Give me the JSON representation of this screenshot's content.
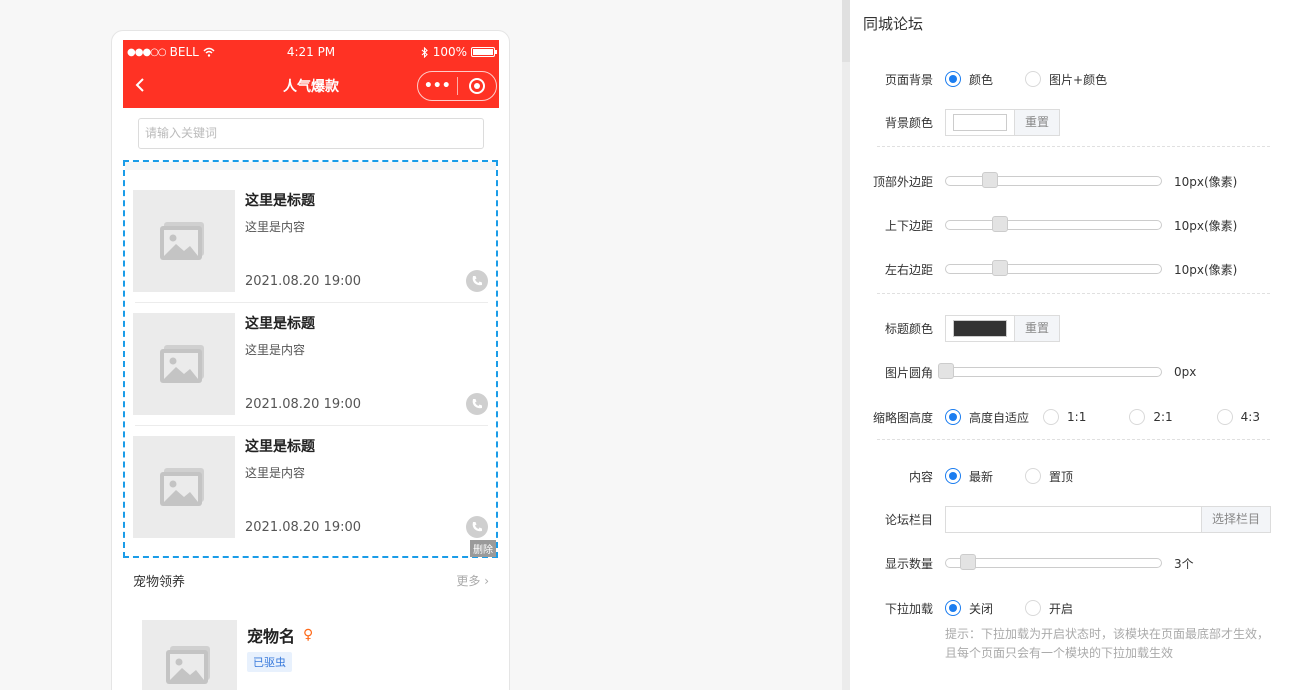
{
  "phone": {
    "status": {
      "carrier": "BELL",
      "time": "4:21 PM",
      "battery": "100%"
    },
    "nav_title": "人气爆款",
    "search_placeholder": "请输入关键词",
    "posts": [
      {
        "title": "这里是标题",
        "content": "这里是内容",
        "date": "2021.08.20 19:00"
      },
      {
        "title": "这里是标题",
        "content": "这里是内容",
        "date": "2021.08.20 19:00"
      },
      {
        "title": "这里是标题",
        "content": "这里是内容",
        "date": "2021.08.20 19:00"
      }
    ],
    "delete_label": "删除",
    "pet_section": {
      "title": "宠物领养",
      "more": "更多",
      "pet_name": "宠物名",
      "badge": "已驱虫"
    }
  },
  "panel": {
    "title": "同城论坛",
    "page_bg": {
      "label": "页面背景",
      "opt1": "颜色",
      "opt2": "图片+颜色",
      "selected": "颜色"
    },
    "bg_color": {
      "label": "背景颜色",
      "value": "#ffffff",
      "reset": "重置"
    },
    "top_margin": {
      "label": "顶部外边距",
      "value": "10px(像素)",
      "level": 10
    },
    "vertical_padding": {
      "label": "上下边距",
      "value": "10px(像素)",
      "level": 10
    },
    "horizontal_padding": {
      "label": "左右边距",
      "value": "10px(像素)",
      "level": 10
    },
    "title_color": {
      "label": "标题颜色",
      "value": "#333333",
      "reset": "重置"
    },
    "image_radius": {
      "label": "图片圆角",
      "value": "0px",
      "level": 0
    },
    "thumb_height": {
      "label": "缩略图高度",
      "opt1": "高度自适应",
      "opt2": "1:1",
      "opt3": "2:1",
      "opt4": "4:3",
      "selected": "高度自适应"
    },
    "content": {
      "label": "内容",
      "opt1": "最新",
      "opt2": "置顶",
      "selected": "最新"
    },
    "forum_column": {
      "label": "论坛栏目",
      "value": "",
      "button": "选择栏目"
    },
    "show_count": {
      "label": "显示数量",
      "value": "3个",
      "level": 3
    },
    "pull_load": {
      "label": "下拉加载",
      "opt1": "关闭",
      "opt2": "开启",
      "selected": "关闭"
    },
    "hint_line1": "提示：下拉加载为开启状态时，该模块在页面最底部才生效，",
    "hint_line2": "且每个页面只会有一个模块的下拉加载生效"
  },
  "colors": {
    "nav_red": "#ff3224",
    "accent_blue": "#1b7df0",
    "selection_blue": "#1a9ce8"
  }
}
